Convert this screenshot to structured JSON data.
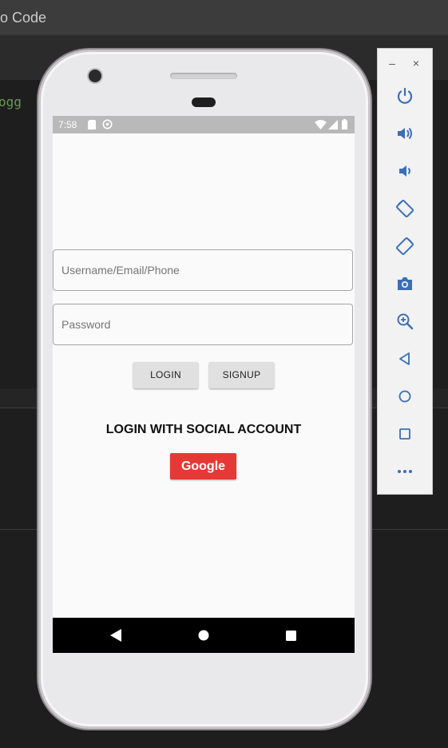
{
  "window": {
    "title_fragment": "io Code"
  },
  "editor": {
    "code_fragment": "ogg"
  },
  "phone": {
    "status_bar": {
      "time": "7:58"
    },
    "form": {
      "username_placeholder": "Username/Email/Phone",
      "password_placeholder": "Password",
      "login_label": "LOGIN",
      "signup_label": "SIGNUP"
    },
    "social": {
      "title": "LOGIN WITH SOCIAL ACCOUNT",
      "google_label": "Google",
      "google_color": "#e53935"
    },
    "nav": [
      "back-icon",
      "home-icon",
      "recents-icon"
    ]
  },
  "emulator_toolbar": {
    "window_controls": [
      "minimize-icon",
      "close-icon"
    ],
    "window_control_glyphs": [
      "–",
      "×"
    ],
    "actions": [
      "power-icon",
      "volume-up-icon",
      "volume-down-icon",
      "rotate-left-icon",
      "rotate-right-icon",
      "screenshot-icon",
      "zoom-icon",
      "back-icon",
      "home-icon",
      "overview-icon",
      "more-icon"
    ],
    "icon_color": "#3b6fb6"
  }
}
